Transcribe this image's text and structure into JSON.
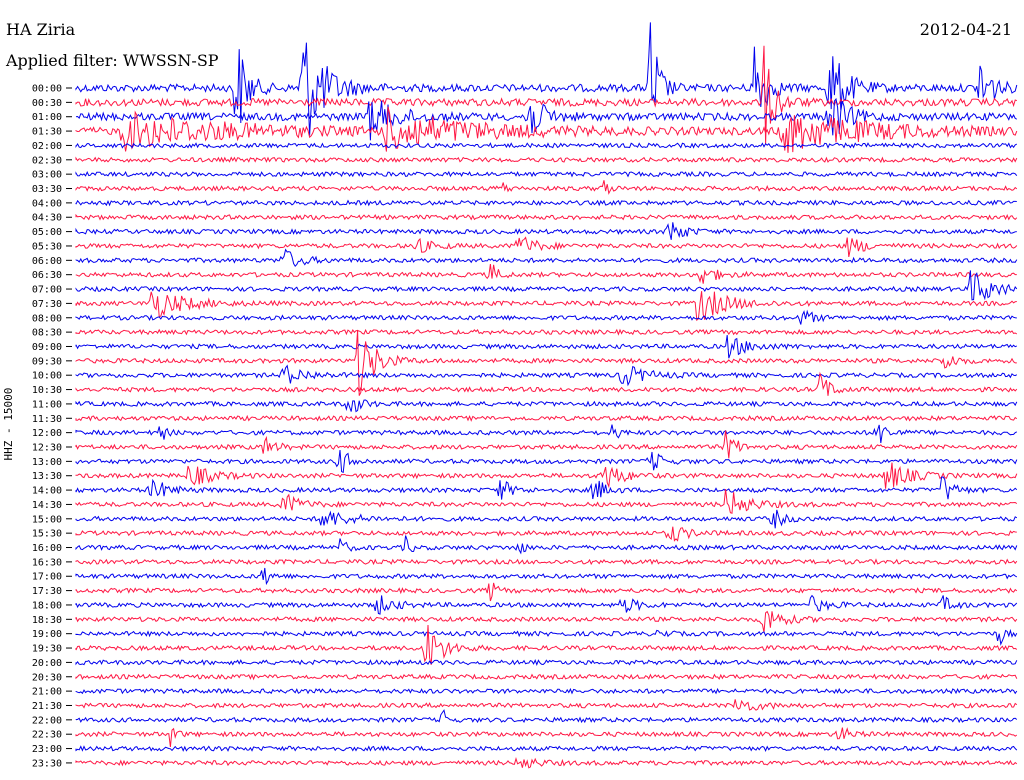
{
  "header": {
    "station": "HA Ziria",
    "date": "2012-04-21",
    "filter": "Applied filter: WWSSN-SP"
  },
  "colors": {
    "even": "#0000ee",
    "odd": "#ff1744",
    "text": "#000000"
  },
  "chart_data": {
    "type": "line",
    "title": "HA Ziria",
    "ylabel": "HHZ - 15000",
    "row_labels": [
      "00:00",
      "00:30",
      "01:00",
      "01:30",
      "02:00",
      "02:30",
      "03:00",
      "03:30",
      "04:00",
      "04:30",
      "05:00",
      "05:30",
      "06:00",
      "06:30",
      "07:00",
      "07:30",
      "08:00",
      "08:30",
      "09:00",
      "09:30",
      "10:00",
      "10:30",
      "11:00",
      "11:30",
      "12:00",
      "12:30",
      "13:00",
      "13:30",
      "14:00",
      "14:30",
      "15:00",
      "15:30",
      "16:00",
      "16:30",
      "17:00",
      "17:30",
      "18:00",
      "18:30",
      "19:00",
      "19:30",
      "20:00",
      "20:30",
      "21:00",
      "21:30",
      "22:00",
      "22:30",
      "23:00",
      "23:30"
    ],
    "events": [
      {
        "row": 0,
        "pos": 0.17,
        "amp": 60,
        "dur": 0.02
      },
      {
        "row": 0,
        "pos": 0.24,
        "amp": 70,
        "dur": 0.04
      },
      {
        "row": 0,
        "pos": 0.61,
        "amp": 80,
        "dur": 0.015
      },
      {
        "row": 0,
        "pos": 0.72,
        "amp": 55,
        "dur": 0.02
      },
      {
        "row": 0,
        "pos": 0.8,
        "amp": 45,
        "dur": 0.03
      },
      {
        "row": 0,
        "pos": 0.96,
        "amp": 40,
        "dur": 0.02
      },
      {
        "row": 1,
        "pos": 0.73,
        "amp": 55,
        "dur": 0.02
      },
      {
        "row": 2,
        "pos": 0.31,
        "amp": 22,
        "dur": 0.05
      },
      {
        "row": 2,
        "pos": 0.48,
        "amp": 25,
        "dur": 0.03
      },
      {
        "row": 2,
        "pos": 0.8,
        "amp": 30,
        "dur": 0.03
      },
      {
        "row": 3,
        "pos": 0.05,
        "amp": 18,
        "dur": 0.2
      },
      {
        "row": 3,
        "pos": 0.33,
        "amp": 20,
        "dur": 0.15
      },
      {
        "row": 3,
        "pos": 0.75,
        "amp": 22,
        "dur": 0.15
      },
      {
        "row": 7,
        "pos": 0.45,
        "amp": 10,
        "dur": 0.01
      },
      {
        "row": 7,
        "pos": 0.56,
        "amp": 10,
        "dur": 0.01
      },
      {
        "row": 10,
        "pos": 0.63,
        "amp": 14,
        "dur": 0.025
      },
      {
        "row": 11,
        "pos": 0.36,
        "amp": 8,
        "dur": 0.03
      },
      {
        "row": 11,
        "pos": 0.47,
        "amp": 12,
        "dur": 0.03
      },
      {
        "row": 11,
        "pos": 0.82,
        "amp": 10,
        "dur": 0.03
      },
      {
        "row": 12,
        "pos": 0.22,
        "amp": 12,
        "dur": 0.03
      },
      {
        "row": 13,
        "pos": 0.44,
        "amp": 12,
        "dur": 0.015
      },
      {
        "row": 13,
        "pos": 0.66,
        "amp": 12,
        "dur": 0.03
      },
      {
        "row": 14,
        "pos": 0.95,
        "amp": 20,
        "dur": 0.04
      },
      {
        "row": 15,
        "pos": 0.08,
        "amp": 16,
        "dur": 0.06
      },
      {
        "row": 15,
        "pos": 0.66,
        "amp": 20,
        "dur": 0.05
      },
      {
        "row": 16,
        "pos": 0.77,
        "amp": 10,
        "dur": 0.02
      },
      {
        "row": 18,
        "pos": 0.69,
        "amp": 12,
        "dur": 0.04
      },
      {
        "row": 19,
        "pos": 0.3,
        "amp": 40,
        "dur": 0.03
      },
      {
        "row": 19,
        "pos": 0.92,
        "amp": 12,
        "dur": 0.02
      },
      {
        "row": 20,
        "pos": 0.22,
        "amp": 10,
        "dur": 0.04
      },
      {
        "row": 20,
        "pos": 0.58,
        "amp": 12,
        "dur": 0.04
      },
      {
        "row": 21,
        "pos": 0.79,
        "amp": 16,
        "dur": 0.02
      },
      {
        "row": 22,
        "pos": 0.29,
        "amp": 14,
        "dur": 0.02
      },
      {
        "row": 24,
        "pos": 0.09,
        "amp": 10,
        "dur": 0.01
      },
      {
        "row": 24,
        "pos": 0.57,
        "amp": 10,
        "dur": 0.01
      },
      {
        "row": 24,
        "pos": 0.85,
        "amp": 14,
        "dur": 0.02
      },
      {
        "row": 25,
        "pos": 0.2,
        "amp": 10,
        "dur": 0.02
      },
      {
        "row": 25,
        "pos": 0.69,
        "amp": 16,
        "dur": 0.02
      },
      {
        "row": 26,
        "pos": 0.28,
        "amp": 14,
        "dur": 0.02
      },
      {
        "row": 26,
        "pos": 0.61,
        "amp": 12,
        "dur": 0.02
      },
      {
        "row": 27,
        "pos": 0.12,
        "amp": 12,
        "dur": 0.04
      },
      {
        "row": 27,
        "pos": 0.56,
        "amp": 16,
        "dur": 0.03
      },
      {
        "row": 27,
        "pos": 0.86,
        "amp": 16,
        "dur": 0.04
      },
      {
        "row": 28,
        "pos": 0.08,
        "amp": 12,
        "dur": 0.03
      },
      {
        "row": 28,
        "pos": 0.45,
        "amp": 12,
        "dur": 0.02
      },
      {
        "row": 28,
        "pos": 0.55,
        "amp": 14,
        "dur": 0.02
      },
      {
        "row": 28,
        "pos": 0.92,
        "amp": 16,
        "dur": 0.02
      },
      {
        "row": 29,
        "pos": 0.22,
        "amp": 12,
        "dur": 0.03
      },
      {
        "row": 29,
        "pos": 0.69,
        "amp": 16,
        "dur": 0.04
      },
      {
        "row": 30,
        "pos": 0.26,
        "amp": 10,
        "dur": 0.05
      },
      {
        "row": 30,
        "pos": 0.74,
        "amp": 10,
        "dur": 0.02
      },
      {
        "row": 31,
        "pos": 0.63,
        "amp": 10,
        "dur": 0.03
      },
      {
        "row": 32,
        "pos": 0.28,
        "amp": 8,
        "dur": 0.015
      },
      {
        "row": 32,
        "pos": 0.35,
        "amp": 10,
        "dur": 0.01
      },
      {
        "row": 32,
        "pos": 0.47,
        "amp": 8,
        "dur": 0.01
      },
      {
        "row": 34,
        "pos": 0.2,
        "amp": 14,
        "dur": 0.01
      },
      {
        "row": 35,
        "pos": 0.44,
        "amp": 12,
        "dur": 0.01
      },
      {
        "row": 36,
        "pos": 0.32,
        "amp": 10,
        "dur": 0.03
      },
      {
        "row": 36,
        "pos": 0.58,
        "amp": 8,
        "dur": 0.03
      },
      {
        "row": 36,
        "pos": 0.78,
        "amp": 8,
        "dur": 0.03
      },
      {
        "row": 36,
        "pos": 0.92,
        "amp": 8,
        "dur": 0.02
      },
      {
        "row": 37,
        "pos": 0.73,
        "amp": 16,
        "dur": 0.03
      },
      {
        "row": 38,
        "pos": 0.62,
        "amp": 8,
        "dur": 0.01
      },
      {
        "row": 38,
        "pos": 0.98,
        "amp": 12,
        "dur": 0.01
      },
      {
        "row": 39,
        "pos": 0.37,
        "amp": 30,
        "dur": 0.03
      },
      {
        "row": 43,
        "pos": 0.7,
        "amp": 8,
        "dur": 0.04
      },
      {
        "row": 44,
        "pos": 0.39,
        "amp": 10,
        "dur": 0.01
      },
      {
        "row": 45,
        "pos": 0.1,
        "amp": 12,
        "dur": 0.01
      },
      {
        "row": 45,
        "pos": 0.81,
        "amp": 8,
        "dur": 0.02
      },
      {
        "row": 47,
        "pos": 0.47,
        "amp": 8,
        "dur": 0.03
      }
    ]
  }
}
